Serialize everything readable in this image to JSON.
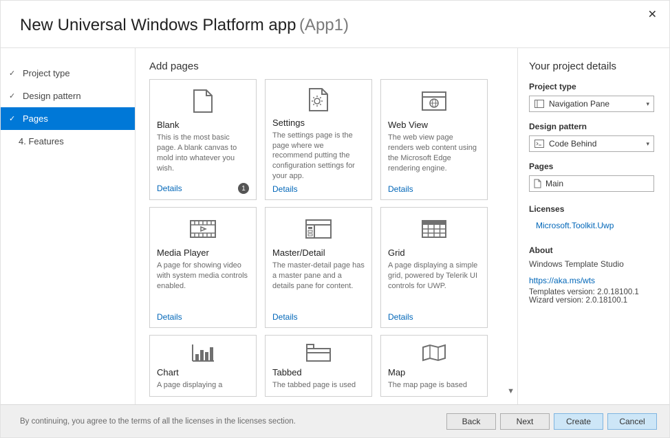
{
  "window": {
    "title": "New Universal Windows Platform app",
    "app_name": "(App1)"
  },
  "sidebar": {
    "items": [
      {
        "label": "Project type",
        "state": "done"
      },
      {
        "label": "Design pattern",
        "state": "done"
      },
      {
        "label": "Pages",
        "state": "active"
      },
      {
        "label": "4.  Features",
        "state": "pending"
      }
    ]
  },
  "main": {
    "title": "Add pages",
    "cards": [
      {
        "title": "Blank",
        "desc": "This is the most basic page. A blank canvas to mold into whatever you wish.",
        "details": "Details",
        "count": "1",
        "icon": "page"
      },
      {
        "title": "Settings",
        "desc": "The settings page is the page where we recommend putting the configuration settings for your app.",
        "details": "Details",
        "icon": "gear-page"
      },
      {
        "title": "Web View",
        "desc": "The web view page renders web content using the Microsoft Edge rendering engine.",
        "details": "Details",
        "icon": "browser-globe"
      },
      {
        "title": "Media Player",
        "desc": "A page for showing video with system media controls enabled.",
        "details": "Details",
        "icon": "film"
      },
      {
        "title": "Master/Detail",
        "desc": "The master-detail page has a master pane and a details pane for content.",
        "details": "Details",
        "icon": "master-detail"
      },
      {
        "title": "Grid",
        "desc": "A page displaying a simple grid, powered by Telerik UI controls for UWP.",
        "details": "Details",
        "icon": "grid"
      },
      {
        "title": "Chart",
        "desc": "A page displaying a",
        "icon": "chart"
      },
      {
        "title": "Tabbed",
        "desc": "The tabbed page is used",
        "icon": "tabbed"
      },
      {
        "title": "Map",
        "desc": "The map page is based",
        "icon": "map"
      }
    ]
  },
  "right": {
    "title": "Your project details",
    "project_type_label": "Project type",
    "project_type_value": "Navigation Pane",
    "design_pattern_label": "Design pattern",
    "design_pattern_value": "Code Behind",
    "pages_label": "Pages",
    "pages_value": "Main",
    "licenses_label": "Licenses",
    "licenses_link": "Microsoft.Toolkit.Uwp",
    "about_label": "About",
    "about_name": "Windows Template Studio",
    "about_link": "https://aka.ms/wts",
    "templates_version": "Templates version: 2.0.18100.1",
    "wizard_version": "Wizard version: 2.0.18100.1"
  },
  "footer": {
    "text": "By continuing, you agree to the terms of all the licenses in the licenses section.",
    "back": "Back",
    "next": "Next",
    "create": "Create",
    "cancel": "Cancel"
  }
}
